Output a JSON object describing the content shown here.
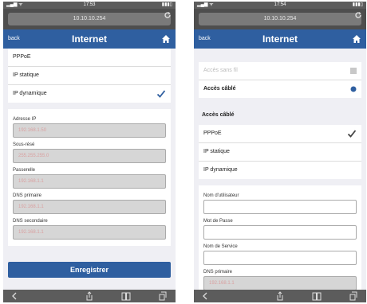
{
  "left": {
    "status": {
      "time": "17:53"
    },
    "url": "10.10.10.254",
    "nav": {
      "back": "back",
      "title": "Internet"
    },
    "connection_options": [
      {
        "label": "PPPoE",
        "checked": false
      },
      {
        "label": "IP statique",
        "checked": false
      },
      {
        "label": "IP dynamique",
        "checked": true
      }
    ],
    "fields": [
      {
        "label": "Adresse IP",
        "value": "192.168.1.50"
      },
      {
        "label": "Sous-résé",
        "value": "255.255.255.0"
      },
      {
        "label": "Passerelle",
        "value": "192.168.1.1"
      },
      {
        "label": "DNS primaire",
        "value": "192.168.1.1"
      },
      {
        "label": "DNS secondaire",
        "value": "192.168.1.1"
      }
    ],
    "save_label": "Enregistrer"
  },
  "right": {
    "status": {
      "time": "17:54"
    },
    "url": "10.10.10.254",
    "nav": {
      "back": "back",
      "title": "Internet"
    },
    "access_options": [
      {
        "label": "Accès sans fil",
        "disabled": true
      },
      {
        "label": "Accès câblé",
        "disabled": false
      }
    ],
    "section_label": "Accès câblé",
    "connection_options": [
      {
        "label": "PPPoE",
        "checked": true
      },
      {
        "label": "IP statique",
        "checked": false
      },
      {
        "label": "IP dynamique",
        "checked": false
      }
    ],
    "fields": [
      {
        "label": "Nom d'utilisateur",
        "value": ""
      },
      {
        "label": "Mot de Passe",
        "value": ""
      },
      {
        "label": "Nom de Service",
        "value": ""
      },
      {
        "label": "DNS primaire",
        "value": "192.168.1.1"
      }
    ]
  },
  "colors": {
    "navbar": "#2f5fa0",
    "check": "#2f5fa0",
    "toolbar": "#5c5c5c"
  }
}
